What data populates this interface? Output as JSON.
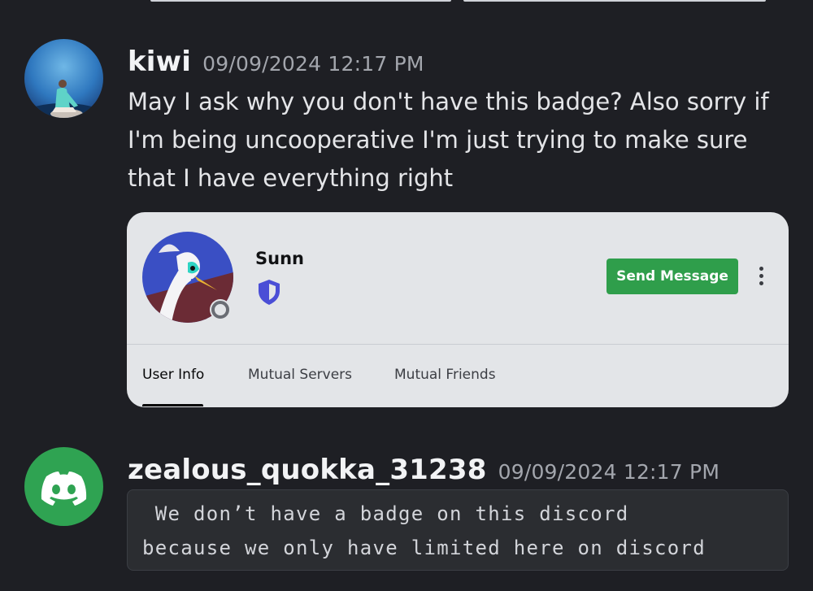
{
  "messages": [
    {
      "username": "kiwi",
      "timestamp": "09/09/2024 12:17 PM",
      "text": "May I ask why you don't have this badge? Also sorry if I'm being uncooperative I'm just trying to make sure that I have everything right",
      "avatar_icon": "user-avatar-illustration"
    },
    {
      "username": "zealous_quokka_31238",
      "timestamp": "09/09/2024 12:17 PM",
      "code_lines": [
        " We don’t have a badge on this discord",
        "because we only have limited here on discord"
      ],
      "avatar_icon": "discord-logo-icon"
    }
  ],
  "profile_card": {
    "name": "Sunn",
    "badge_icon": "shield-badge-icon",
    "send_button": "Send Message",
    "tabs": [
      {
        "label": "User Info",
        "active": true
      },
      {
        "label": "Mutual Servers",
        "active": false
      },
      {
        "label": "Mutual Friends",
        "active": false
      }
    ]
  },
  "colors": {
    "background": "#1e1f24",
    "send_button": "#2f9e4b",
    "discord_avatar": "#2fa352",
    "badge": "#4a4ed6"
  }
}
